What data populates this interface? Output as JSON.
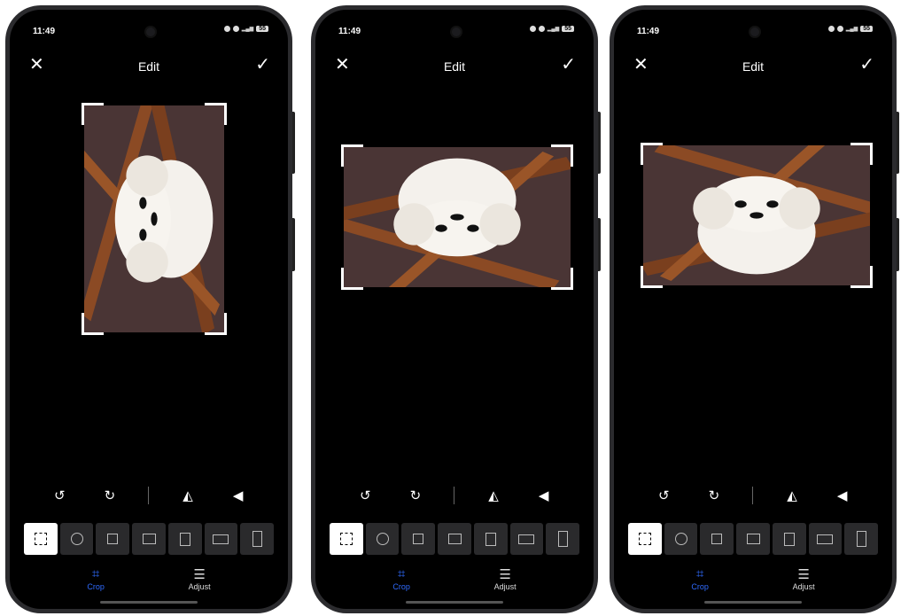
{
  "phones": [
    {
      "status_time": "11:49",
      "battery": "55"
    },
    {
      "status_time": "11:49",
      "battery": "55"
    },
    {
      "status_time": "11:49",
      "battery": "55"
    }
  ],
  "header": {
    "title": "Edit",
    "close_icon": "close-icon",
    "confirm_icon": "check-icon"
  },
  "tools": [
    "rotate-left-icon",
    "rotate-right-icon",
    "flip-horizontal-icon",
    "flip-vertical-icon"
  ],
  "ratio_options": [
    "free",
    "circle",
    "1:1",
    "4:3",
    "3:4",
    "16:9",
    "9:16"
  ],
  "tabs": {
    "crop_label": "Crop",
    "adjust_label": "Adjust"
  },
  "colors": {
    "accent": "#2f6bff",
    "background": "#000000",
    "ratio_bg": "#2a2a2c"
  }
}
